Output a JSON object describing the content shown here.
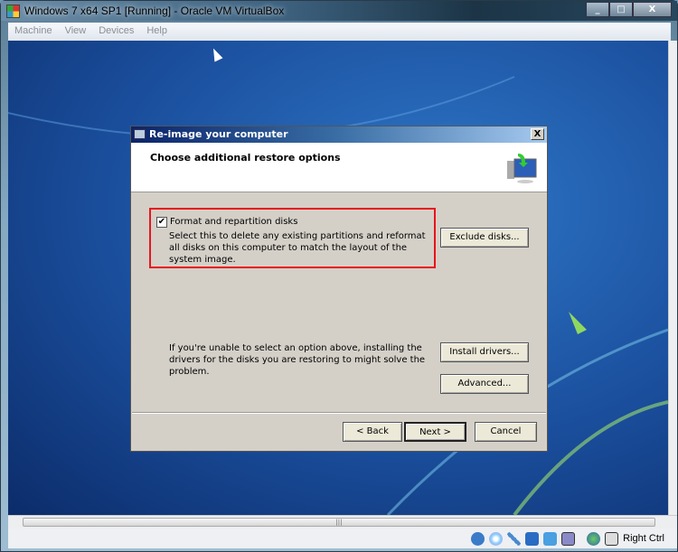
{
  "window": {
    "title": "Windows 7 x64 SP1 [Running] - Oracle VM VirtualBox",
    "controls": [
      "_",
      "□",
      "X"
    ]
  },
  "menu": [
    "Machine",
    "View",
    "Devices",
    "Help"
  ],
  "dialog": {
    "title": "Re-image your computer",
    "heading": "Choose additional restore options",
    "format_checkbox": {
      "label": "Format and repartition disks",
      "checked": true,
      "mark": "✔"
    },
    "format_description": "Select this to delete any existing partitions and reformat all disks on this computer to match the layout of the system image.",
    "exclude_button": "Exclude disks...",
    "drivers_hint": "If you're unable to select an option above, installing the drivers for the disks you are restoring to might solve the problem.",
    "install_drivers_button": "Install drivers...",
    "advanced_button": "Advanced...",
    "back_button": "< Back",
    "next_button": "Next >",
    "cancel_button": "Cancel",
    "close": "X",
    "highlight_color": "#e8141c"
  },
  "statusbar": {
    "host_key": "Right Ctrl",
    "icons": [
      "hard-disk-icon",
      "cd-icon",
      "usb-icon",
      "network-icon",
      "shared-folder-icon",
      "virtualization-icon",
      "mouse-integration-icon",
      "host-key-icon"
    ]
  },
  "hscroll": {
    "grip": "|||"
  }
}
